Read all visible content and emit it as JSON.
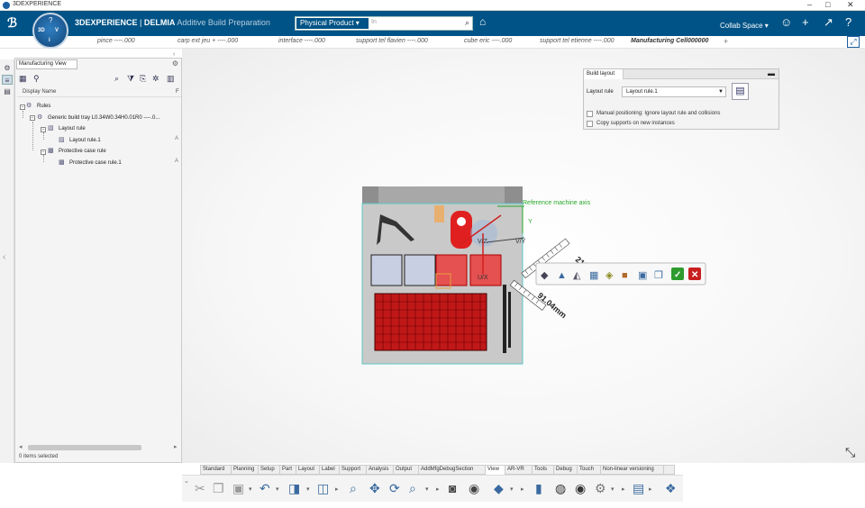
{
  "window": {
    "title": "3DEXPERIENCE",
    "controls": [
      "–",
      "□",
      "✕"
    ]
  },
  "header": {
    "brand_prefix": "3DEXPERIENCE",
    "brand_sep": " | ",
    "brand_main": "DELMIA",
    "brand_app": " Additive Build Preparation",
    "compass": {
      "left": "3D",
      "right": "V",
      "top": "?",
      "bottom": "i"
    },
    "search": {
      "category": "Physical Product ▾",
      "placeholder": "In"
    },
    "collab_space": "Collab Space ▾"
  },
  "tabs": [
    {
      "label": "pince ----.000"
    },
    {
      "label": "carp ext jeu + ----.000"
    },
    {
      "label": "interface ----.000"
    },
    {
      "label": "support tel flavien ----.000"
    },
    {
      "label": "cube eric ----.000"
    },
    {
      "label": "support tel etienne ----.000"
    },
    {
      "label": "Manufacturing Cell000000"
    }
  ],
  "left_panel": {
    "tab": "Manufacturing View",
    "column": "Display Name",
    "column_right": "F",
    "tree": [
      {
        "label": "Rules",
        "level": 0,
        "icon": "rules-icon"
      },
      {
        "label": "Generic build tray L0.34W0.34H0.01R0 ----.0...",
        "level": 1,
        "icon": "tray-icon"
      },
      {
        "label": "Layout rule",
        "level": 2,
        "icon": "layout-rule-icon"
      },
      {
        "label": "Layout rule.1",
        "level": 3,
        "icon": "layout-rule-instance-icon",
        "tag": "A"
      },
      {
        "label": "Protective case rule",
        "level": 2,
        "icon": "protective-case-icon"
      },
      {
        "label": "Protective case rule.1",
        "level": 3,
        "icon": "protective-case-instance-icon",
        "tag": "A"
      }
    ],
    "status": "0 items selected"
  },
  "build_layout": {
    "title": "Build layout",
    "layout_rule_label": "Layout rule",
    "layout_rule_value": "Layout rule.1",
    "option1": "Manual positioning: Ignore layout rule and collisions",
    "option2": "Copy supports on new instances"
  },
  "viewport": {
    "ref_axis_label": "Reference machine axis",
    "y_label": "Y",
    "vz_label": "V/Z",
    "vy_label": "V/Y",
    "ux_label": "U/X",
    "ruler_top_value": "215",
    "ruler_bottom_value": "91.04mm"
  },
  "toolbar_tabs": [
    "Standard",
    "Planning",
    "Setup",
    "Part",
    "Layout",
    "Label",
    "Support",
    "Analysis",
    "Output",
    "AddMfgDebugSection",
    "View",
    "AR-VR",
    "Tools",
    "Debug",
    "Touch",
    "Non-linear versioning"
  ],
  "active_toolbar_tab": "View",
  "colors": {
    "header": "#005386",
    "selection_red": "#e02020",
    "tray": "#c9c9c9"
  }
}
